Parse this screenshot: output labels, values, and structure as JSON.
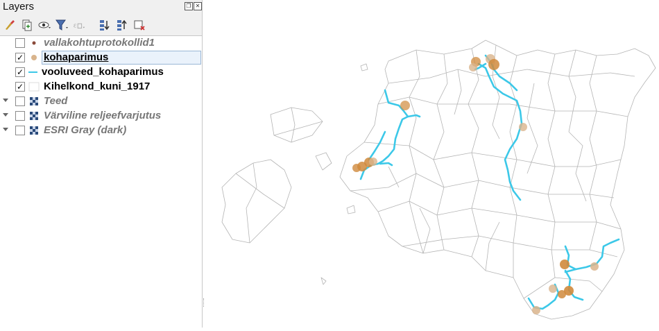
{
  "panel": {
    "title": "Layers",
    "float_button": "❐",
    "close_button": "✕"
  },
  "toolbar": {
    "tools": [
      {
        "name": "style-manager-icon"
      },
      {
        "name": "add-group-icon"
      },
      {
        "name": "visibility-icon"
      },
      {
        "name": "filter-icon"
      },
      {
        "name": "filter-expression-icon"
      },
      {
        "name": "expand-all-icon"
      },
      {
        "name": "collapse-all-icon"
      },
      {
        "name": "remove-layer-icon"
      }
    ]
  },
  "layers": [
    {
      "label": "vallakohtuprotokollid1",
      "checked": false,
      "checkmark": "",
      "style": "off",
      "symbol": "small-dot",
      "expandable": false
    },
    {
      "label": "kohaparimus",
      "checked": true,
      "checkmark": "✓",
      "style": "on",
      "symbol": "point",
      "expandable": false,
      "selected": true
    },
    {
      "label": "vooluveed_kohaparimus",
      "checked": true,
      "checkmark": "✓",
      "style": "on",
      "symbol": "line",
      "expandable": false
    },
    {
      "label": "Kihelkond_kuni_1917",
      "checked": true,
      "checkmark": "✓",
      "style": "on",
      "symbol": "polygon",
      "expandable": false
    },
    {
      "label": "Teed",
      "checked": false,
      "checkmark": "",
      "style": "off",
      "symbol": "raster",
      "expandable": true
    },
    {
      "label": "Värviline reljeefvarjutus",
      "checked": false,
      "checkmark": "",
      "style": "off",
      "symbol": "raster",
      "expandable": true
    },
    {
      "label": "ESRI Gray (dark)",
      "checked": false,
      "checkmark": "",
      "style": "off",
      "symbol": "raster",
      "expandable": true
    }
  ],
  "colors": {
    "point": "#d08a3c",
    "point_light": "#d9b48c",
    "river": "#3cc8e8",
    "boundary": "#b4b4b4",
    "selection": "#eaf2fb"
  }
}
